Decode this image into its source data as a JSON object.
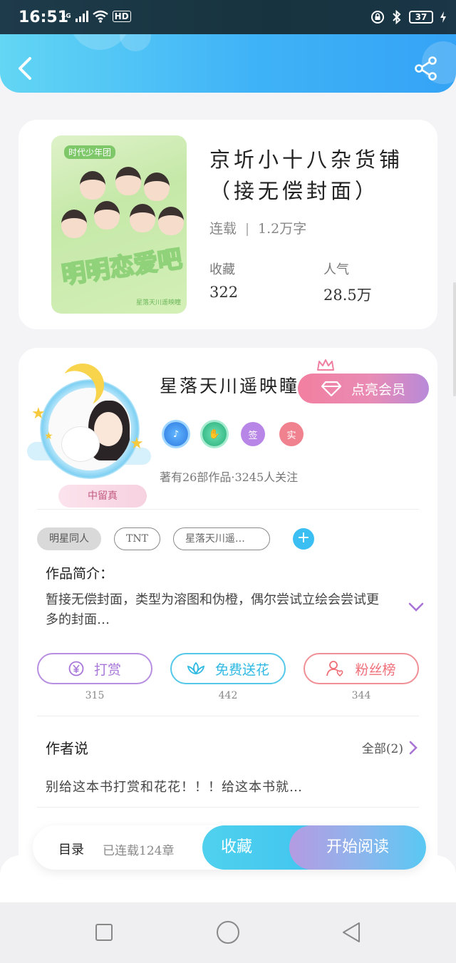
{
  "status_bar": {
    "time": "16:51",
    "network": "4G",
    "hd": "HD",
    "battery": "37"
  },
  "book": {
    "title_line1": "京圻小十八杂货铺",
    "title_line2": "（接无偿封面）",
    "status": "连载",
    "word_count": "1.2万字",
    "favorites_label": "收藏",
    "favorites_value": "322",
    "popularity_label": "人气",
    "popularity_value": "28.5万",
    "cover": {
      "top_label": "时代少年团",
      "big_text": "明明恋爱吧",
      "small_text": "星落天川遥映瞳"
    }
  },
  "author": {
    "name": "星落天川遥映瞳",
    "vip_label": "点亮会员",
    "badge_name": "中留真",
    "medals": [
      {
        "text": "",
        "icon": "music-note-icon",
        "color": "#3a8ff0"
      },
      {
        "text": "",
        "icon": "handshake-icon",
        "color": "#3cc48f"
      },
      {
        "text": "签",
        "icon": "signed-badge",
        "color": "#b57ee8"
      },
      {
        "text": "实",
        "icon": "verified-badge",
        "color": "#f27f8e"
      }
    ],
    "works_info": "著有26部作品·3245人关注"
  },
  "tags": [
    "明星同人",
    "TNT",
    "星落天川遥…"
  ],
  "intro": {
    "title": "作品简介：",
    "text": "暂接无偿封面，类型为溶图和伪橙，偶尔尝试立绘会尝试更多的封面…"
  },
  "actions": [
    {
      "label": "打赏",
      "count": "315",
      "icon": "yen-coin-icon",
      "color": "#a876d8"
    },
    {
      "label": "免费送花",
      "count": "442",
      "icon": "lotus-flower-icon",
      "color": "#2fb9e3"
    },
    {
      "label": "粉丝榜",
      "count": "344",
      "icon": "fan-user-icon",
      "color": "#ef6f78"
    }
  ],
  "author_says": {
    "title": "作者说",
    "all_label": "全部(2)",
    "text": "别给这本书打赏和花花！！！给这本书就…"
  },
  "bottom_bar": {
    "toc_label": "目录",
    "toc_count": "已连载124章",
    "favorite_label": "收藏",
    "read_label": "开始阅读"
  }
}
